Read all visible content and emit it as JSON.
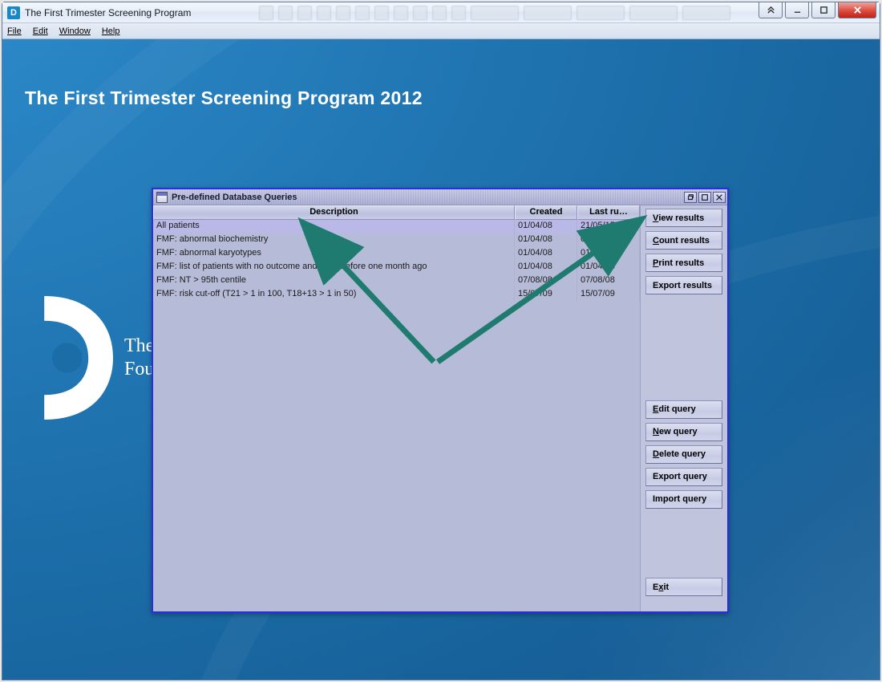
{
  "app": {
    "title": "The First Trimester Screening Program"
  },
  "menubar": {
    "file": "File",
    "edit": "Edit",
    "window": "Window",
    "help": "Help"
  },
  "page": {
    "heading": "The First Trimester Screening Program 2012"
  },
  "logo": {
    "line1": "The",
    "line2": "Fou"
  },
  "dialog": {
    "title": "Pre-defined Database Queries",
    "columns": {
      "description": "Description",
      "created": "Created",
      "lastrun": "Last ru…"
    },
    "rows": [
      {
        "desc": "All patients",
        "created": "01/04/08",
        "lastrun": "21/05/15",
        "selected": true
      },
      {
        "desc": "FMF: abnormal biochemistry",
        "created": "01/04/08",
        "lastrun": "01/04/08",
        "selected": false
      },
      {
        "desc": "FMF: abnormal karyotypes",
        "created": "01/04/08",
        "lastrun": "01/04/08",
        "selected": false
      },
      {
        "desc": "FMF: list of patients with no outcome and EDD  before one month ago",
        "created": "01/04/08",
        "lastrun": "01/04/08",
        "selected": false
      },
      {
        "desc": "FMF: NT > 95th centile",
        "created": "07/08/08",
        "lastrun": "07/08/08",
        "selected": false
      },
      {
        "desc": "FMF: risk cut-off (T21 > 1 in 100, T18+13 > 1 in 50)",
        "created": "15/07/09",
        "lastrun": "15/07/09",
        "selected": false
      }
    ],
    "buttons": {
      "view_results": "View results",
      "count_results": "Count results",
      "print_results": "Print results",
      "export_results": "Export results",
      "edit_query": "Edit query",
      "new_query": "New query",
      "delete_query": "Delete query",
      "export_query": "Export query",
      "import_query": "Import query",
      "exit": "Exit"
    }
  }
}
